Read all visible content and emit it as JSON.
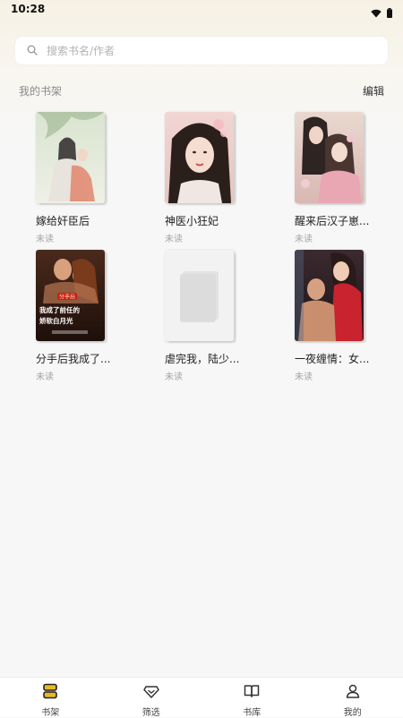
{
  "status_bar": {
    "time": "10:28"
  },
  "search": {
    "placeholder": "搜索书名/作者"
  },
  "shelf": {
    "title": "我的书架",
    "edit_label": "编辑",
    "books": [
      {
        "title": "嫁给奸臣后",
        "status": "未读"
      },
      {
        "title": "神医小狂妃",
        "status": "未读"
      },
      {
        "title": "醒来后汉子崽...",
        "status": "未读"
      },
      {
        "title": "分手后我成了...",
        "status": "未读",
        "cover_text": "我成了前任的娇软白月光",
        "cover_badge": "分手后"
      },
      {
        "title": "虐完我，陆少...",
        "status": "未读"
      },
      {
        "title": "一夜缠情：女...",
        "status": "未读"
      }
    ]
  },
  "nav": {
    "items": [
      {
        "label": "书架",
        "icon": "bookshelf-icon"
      },
      {
        "label": "筛选",
        "icon": "filter-gem-icon"
      },
      {
        "label": "书库",
        "icon": "open-book-icon"
      },
      {
        "label": "我的",
        "icon": "person-icon"
      }
    ]
  },
  "colors": {
    "accent": "#e8b923",
    "background": "#f7f7f7",
    "text_muted": "#a3a3a3"
  }
}
